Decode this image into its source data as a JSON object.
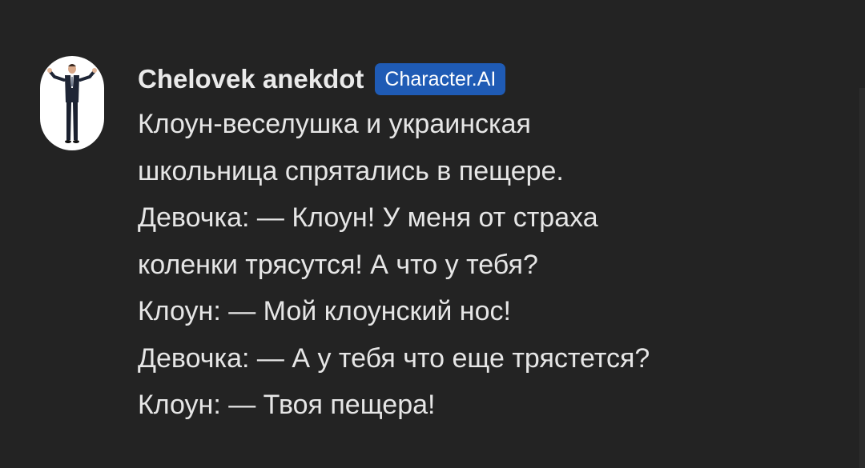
{
  "message": {
    "author": "Chelovek anekdot",
    "badge": "Character.AI",
    "avatar_icon": "man-in-suit-avatar",
    "lines": [
      "Клоун-веселушка и украинская",
      "школьница спрятались в пещере.",
      "Девочка: — Клоун! У меня от страха",
      "коленки трясутся! А что у тебя?",
      "Клоун: — Мой клоунский нос!",
      "Девочка: — А у тебя что еще трястется?",
      "Клоун: — Твоя пещера!"
    ]
  },
  "colors": {
    "background": "#232323",
    "text": "#e6e6e6",
    "badge": "#1f5bb5"
  }
}
